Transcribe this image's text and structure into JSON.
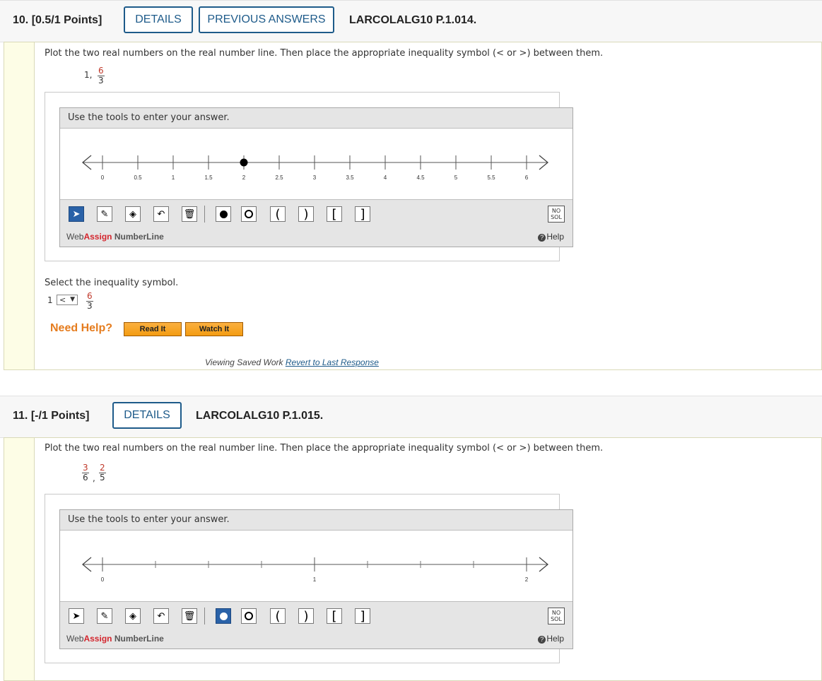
{
  "q10": {
    "number": "10.",
    "points": "[0.5/1 Points]",
    "details_label": "DETAILS",
    "previous_answers_label": "PREVIOUS ANSWERS",
    "code": "LARCOLALG10 P.1.014.",
    "prompt": "Plot the two real numbers on the real number line. Then place the appropriate inequality symbol (< or >) between them.",
    "numbers": {
      "first": "1,",
      "frac_num": "6",
      "frac_den": "3"
    },
    "tool_header": "Use the tools to enter your answer.",
    "ticks": [
      "0",
      "0.5",
      "1",
      "1.5",
      "2",
      "2.5",
      "3",
      "3.5",
      "4",
      "4.5",
      "5",
      "5.5",
      "6"
    ],
    "plotted_point": 2,
    "select_prompt": "Select the inequality symbol.",
    "select_left": "1",
    "select_value": "<",
    "select_frac_num": "6",
    "select_frac_den": "3",
    "need_help": "Need Help?",
    "read_it": "Read It",
    "watch_it": "Watch It",
    "viewing_text": "Viewing Saved Work",
    "revert_text": "Revert to Last Response"
  },
  "q11": {
    "number": "11.",
    "points": "[-/1 Points]",
    "details_label": "DETAILS",
    "code": "LARCOLALG10 P.1.015.",
    "prompt": "Plot the two real numbers on the real number line. Then place the appropriate inequality symbol (< or >) between them.",
    "frac1_num": "3",
    "frac1_den": "6",
    "frac2_num": "2",
    "frac2_den": "5",
    "tool_header": "Use the tools to enter your answer.",
    "ticks": [
      "0",
      "1",
      "2"
    ]
  },
  "numberline": {
    "brand_web": "Web",
    "brand_assign": "Assign",
    "brand_suffix": "NumberLine",
    "help": "Help",
    "nosol_line1": "NO",
    "nosol_line2": "SOL"
  },
  "colors": {
    "accent": "#1e5b8a",
    "fraction_red": "#c0392b",
    "need_help": "#e57c1e",
    "selected_tool": "#2a62a8"
  }
}
